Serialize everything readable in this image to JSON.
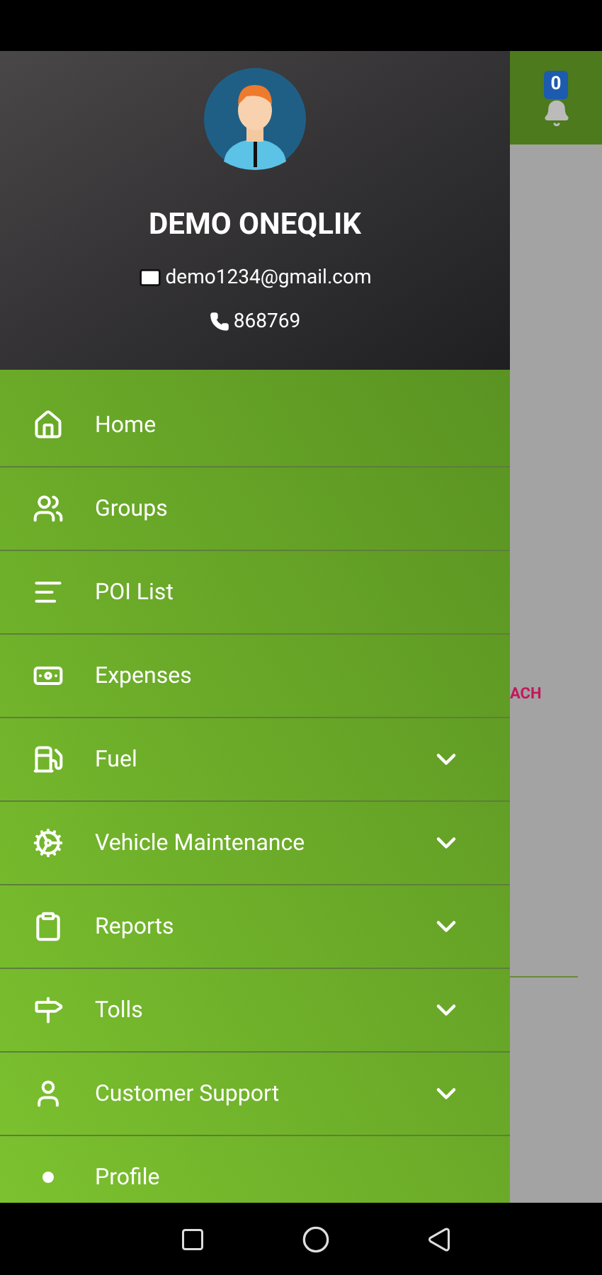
{
  "app_bar": {
    "notification_count": "0"
  },
  "background": {
    "text": "ACH"
  },
  "drawer": {
    "header": {
      "name": "DEMO ONEQLIK",
      "email": "demo1234@gmail.com",
      "phone": "868769"
    },
    "items": [
      {
        "label": "Home",
        "expandable": false
      },
      {
        "label": "Groups",
        "expandable": false
      },
      {
        "label": "POI List",
        "expandable": false
      },
      {
        "label": "Expenses",
        "expandable": false
      },
      {
        "label": "Fuel",
        "expandable": true
      },
      {
        "label": "Vehicle Maintenance",
        "expandable": true
      },
      {
        "label": "Reports",
        "expandable": true
      },
      {
        "label": "Tolls",
        "expandable": true
      },
      {
        "label": "Customer Support",
        "expandable": true
      },
      {
        "label": "Profile",
        "expandable": false
      }
    ]
  }
}
